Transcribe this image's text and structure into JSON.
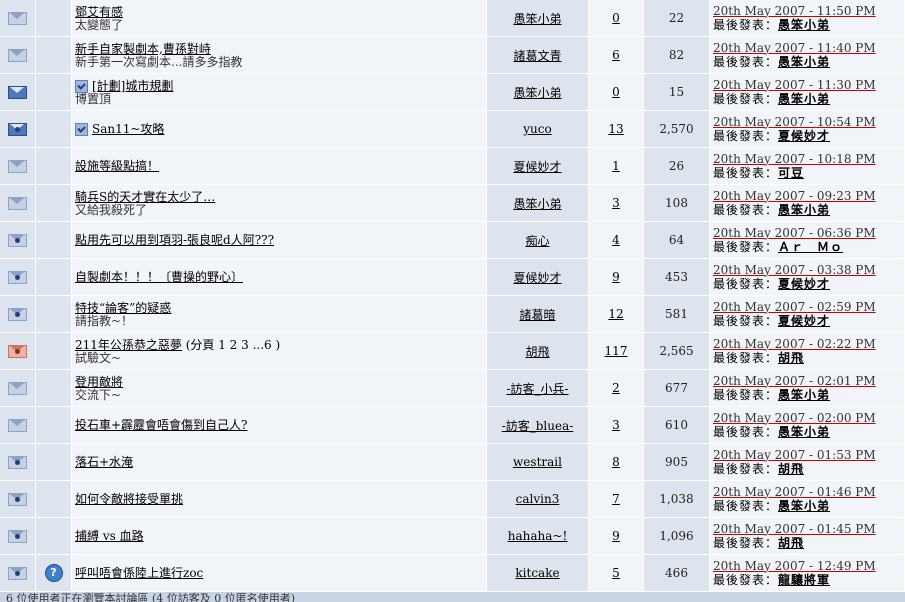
{
  "last_post_label": "最後發表：",
  "rows": [
    {
      "icon": "light",
      "posticon": "",
      "title": "鄧艾有感",
      "pages": "",
      "sub": "太變態了",
      "author": "愚笨小弟",
      "replies": "0",
      "views": "22",
      "last_date": "20th May 2007 - 11:50 PM",
      "last_by": "愚笨小弟"
    },
    {
      "icon": "light",
      "posticon": "",
      "title": "新手自家製劇本,曹孫對峙",
      "pages": "",
      "sub": "新手第一次寫劇本...請多多指教",
      "author": "諸葛文青",
      "replies": "6",
      "views": "82",
      "last_date": "20th May 2007 - 11:40 PM",
      "last_by": "愚笨小弟"
    },
    {
      "icon": "dark",
      "posticon": "topic",
      "title": "[計劃]城市規劃",
      "pages": "",
      "sub": "博置頂",
      "author": "愚笨小弟",
      "replies": "0",
      "views": "15",
      "last_date": "20th May 2007 - 11:30 PM",
      "last_by": "愚笨小弟"
    },
    {
      "icon": "darkdot",
      "posticon": "topic",
      "title": "San11~攻略",
      "pages": "",
      "sub": "",
      "author": "yuco",
      "replies": "13",
      "views": "2,570",
      "last_date": "20th May 2007 - 10:54 PM",
      "last_by": "夏候妙才"
    },
    {
      "icon": "light",
      "posticon": "",
      "title": "設施等級點搞！",
      "pages": "",
      "sub": "",
      "author": "夏候妙才",
      "replies": "1",
      "views": "26",
      "last_date": "20th May 2007 - 10:18 PM",
      "last_by": "可豆"
    },
    {
      "icon": "light",
      "posticon": "",
      "title": "騎兵S的天才實在太少了…",
      "pages": "",
      "sub": "又給我殺死了",
      "author": "愚笨小弟",
      "replies": "3",
      "views": "108",
      "last_date": "20th May 2007 - 09:23 PM",
      "last_by": "愚笨小弟"
    },
    {
      "icon": "dot",
      "posticon": "",
      "title": "點用先可以用到項羽-張良呢d人阿???",
      "pages": "",
      "sub": "",
      "author": "痴心",
      "replies": "4",
      "views": "64",
      "last_date": "20th May 2007 - 06:36 PM",
      "last_by": "Ａｒ　Ｍｏ"
    },
    {
      "icon": "dot",
      "posticon": "",
      "title": "自製劇本！！！〔曹操的野心〕",
      "pages": "",
      "sub": "",
      "author": "夏候妙才",
      "replies": "9",
      "views": "453",
      "last_date": "20th May 2007 - 03:38 PM",
      "last_by": "夏候妙才"
    },
    {
      "icon": "dot",
      "posticon": "",
      "title": "特技“論客”的疑惑",
      "pages": "",
      "sub": "請指教~！",
      "author": "諸葛暗",
      "replies": "12",
      "views": "581",
      "last_date": "20th May 2007 - 02:59 PM",
      "last_by": "夏候妙才"
    },
    {
      "icon": "hot",
      "posticon": "",
      "title": "211年公孫恭之惡夢",
      "pages": "(分頁 1 2 3 ...6 )",
      "sub": "試驗文~",
      "author": "胡飛",
      "replies": "117",
      "views": "2,565",
      "last_date": "20th May 2007 - 02:22 PM",
      "last_by": "胡飛"
    },
    {
      "icon": "light",
      "posticon": "",
      "title": "登用敵將",
      "pages": "",
      "sub": "交流下~",
      "author": "-訪客_小兵-",
      "replies": "2",
      "views": "677",
      "last_date": "20th May 2007 - 02:01 PM",
      "last_by": "愚笨小弟"
    },
    {
      "icon": "light",
      "posticon": "",
      "title": "投石車+霹靂會唔會傷到自己人?",
      "pages": "",
      "sub": "",
      "author": "-訪客_bluea-",
      "replies": "3",
      "views": "610",
      "last_date": "20th May 2007 - 02:00 PM",
      "last_by": "愚笨小弟"
    },
    {
      "icon": "dot",
      "posticon": "",
      "title": "落石+水淹",
      "pages": "",
      "sub": "",
      "author": "westrail",
      "replies": "8",
      "views": "905",
      "last_date": "20th May 2007 - 01:53 PM",
      "last_by": "胡飛"
    },
    {
      "icon": "dot",
      "posticon": "",
      "title": "如何令敵將接受單挑",
      "pages": "",
      "sub": "",
      "author": "calvin3",
      "replies": "7",
      "views": "1,038",
      "last_date": "20th May 2007 - 01:46 PM",
      "last_by": "愚笨小弟"
    },
    {
      "icon": "dot",
      "posticon": "",
      "title": "捕縛 vs 血路",
      "pages": "",
      "sub": "",
      "author": "hahaha~!",
      "replies": "9",
      "views": "1,096",
      "last_date": "20th May 2007 - 01:45 PM",
      "last_by": "胡飛"
    },
    {
      "icon": "dot",
      "posticon": "question",
      "title": "呼叫唔會係陸上進行zoc",
      "pages": "",
      "sub": "",
      "author": "kitcake",
      "replies": "5",
      "views": "466",
      "last_date": "20th May 2007 - 12:49 PM",
      "last_by": "龍驤將軍"
    }
  ],
  "footer": "6 位使用者正在瀏覽本討論區 (4 位訪客及 0 位匿名使用者)"
}
